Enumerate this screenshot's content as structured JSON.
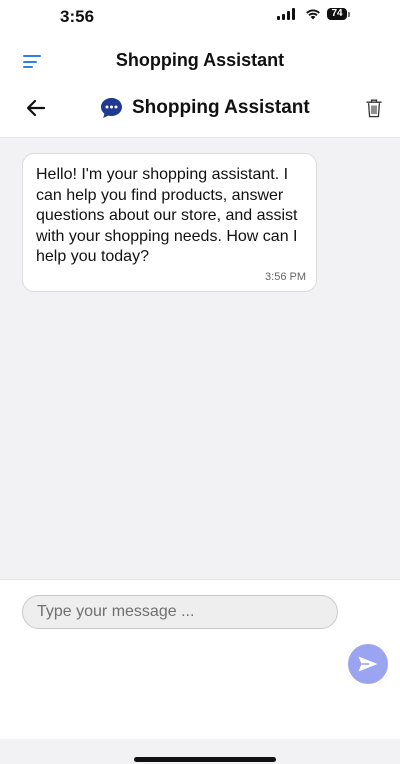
{
  "status_bar": {
    "time": "3:56",
    "battery_level": "74",
    "icons": [
      "signal-icon",
      "wifi-icon",
      "battery-icon"
    ]
  },
  "app_header": {
    "title": "Shopping Assistant",
    "menu_icon": "hamburger-menu-icon",
    "accent_color": "#2f80ed"
  },
  "chat_header": {
    "title": "Shopping Assistant",
    "back_icon": "arrow-left-icon",
    "avatar_icon": "chat-bubble-icon",
    "delete_icon": "trash-icon",
    "avatar_color": "#1f3a93"
  },
  "messages": [
    {
      "sender": "assistant",
      "text": "Hello! I'm your shopping assistant. I can help you find products, answer questions about our store, and assist with your shopping needs. How can I help you today?",
      "time": "3:56 PM"
    }
  ],
  "composer": {
    "placeholder": "Type your message ...",
    "value": "",
    "send_icon": "send-icon",
    "send_color": "#9aa4f0"
  }
}
